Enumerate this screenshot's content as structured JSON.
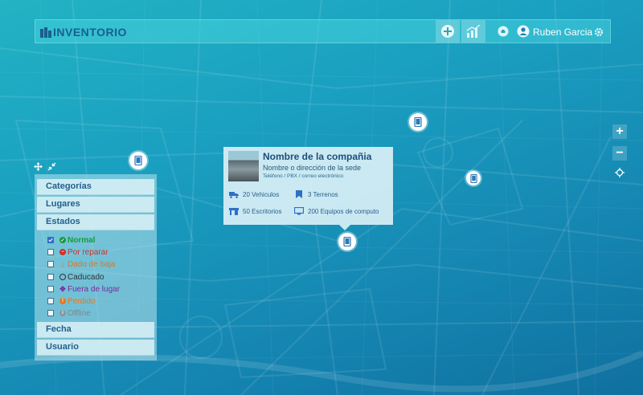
{
  "header": {
    "logo_text": "INVENTORIO",
    "add_icon": "plus-circle-icon",
    "stats_icon": "bar-chart-icon",
    "notification_icon": "bell-icon",
    "user_icon": "user-icon",
    "user_name": "Ruben Garcia",
    "settings_icon": "gear-icon"
  },
  "popup": {
    "title": "Nombre de la compañia",
    "subtitle": "Nombre o dirección de la sede",
    "contact": "Teléfono / PBX / correo electrónico",
    "stats": [
      {
        "icon": "truck-icon",
        "label": "20 Vehiculos"
      },
      {
        "icon": "bookmark-icon",
        "label": "3 Terrenos"
      },
      {
        "icon": "desk-icon",
        "label": "50 Escritorios"
      },
      {
        "icon": "monitor-icon",
        "label": "200 Equipos de computo"
      }
    ]
  },
  "filters": {
    "sections": {
      "categorias": "Categorías",
      "lugares": "Lugares",
      "estados": "Estados",
      "fecha": "Fecha",
      "usuario": "Usuario"
    },
    "estados": [
      {
        "label": "Normal",
        "checked": true,
        "color": "#1a9a3c"
      },
      {
        "label": "Por reparar",
        "checked": false,
        "color": "#d0302a"
      },
      {
        "label": "Dado de baja",
        "checked": false,
        "color": "#d27a2e"
      },
      {
        "label": "Caducado",
        "checked": false,
        "color": "#333333"
      },
      {
        "label": "Fuera de lugar",
        "checked": false,
        "color": "#7a2a9a"
      },
      {
        "label": "Perdido",
        "checked": false,
        "color": "#e07a20"
      },
      {
        "label": "Offline",
        "checked": false,
        "color": "#7a8a90"
      }
    ]
  },
  "map_controls": {
    "zoom_in": "+",
    "zoom_out": "−",
    "locate_icon": "crosshair-icon",
    "move_icon": "move-icon",
    "collapse_icon": "collapse-arrows-icon"
  },
  "markers_icon": "tablet-icon"
}
